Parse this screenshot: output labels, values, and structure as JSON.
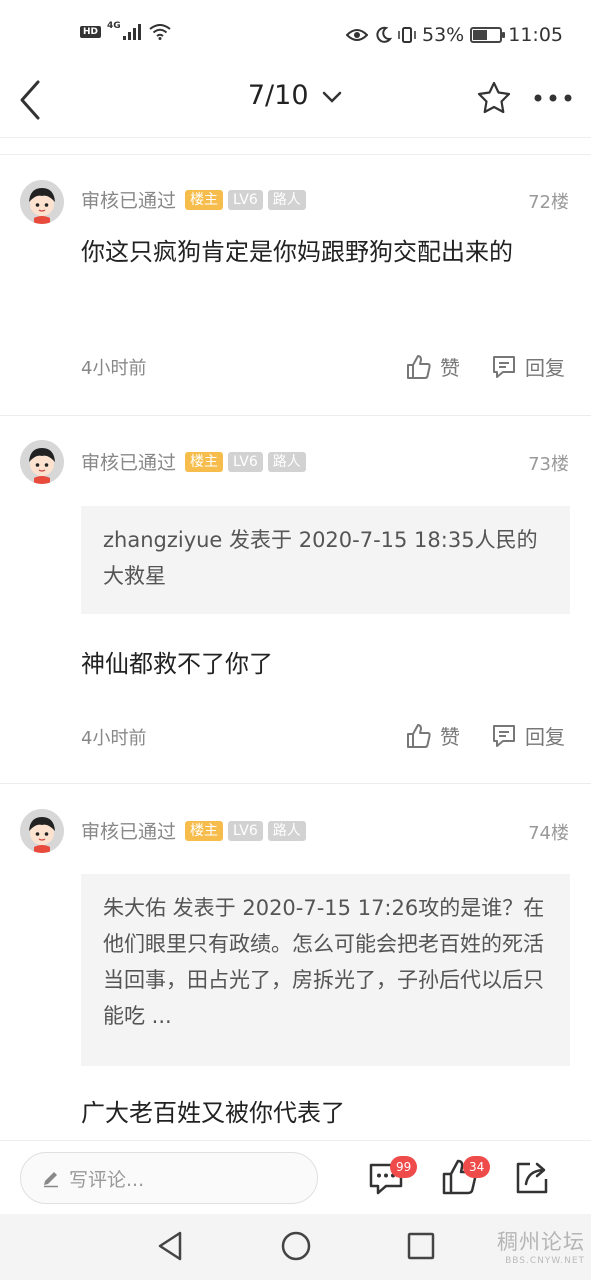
{
  "status_bar": {
    "hd": "HD",
    "network": "4G",
    "battery_percent": "53%",
    "battery_level": 0.53,
    "time": "11:05"
  },
  "topnav": {
    "page_indicator": "7/10"
  },
  "posts": [
    {
      "author": "审核已通过",
      "badge_owner": "楼主",
      "badge_level": "LV6",
      "badge_role": "路人",
      "floor": "72楼",
      "text": "你这只疯狗肯定是你妈跟野狗交配出来的",
      "time": "4小时前",
      "like_label": "赞",
      "reply_label": "回复"
    },
    {
      "author": "审核已通过",
      "badge_owner": "楼主",
      "badge_level": "LV6",
      "badge_role": "路人",
      "floor": "73楼",
      "quote": "zhangziyue 发表于 2020-7-15 18:35人民的大救星",
      "text": "神仙都救不了你了",
      "time": "4小时前",
      "like_label": "赞",
      "reply_label": "回复"
    },
    {
      "author": "审核已通过",
      "badge_owner": "楼主",
      "badge_level": "LV6",
      "badge_role": "路人",
      "floor": "74楼",
      "quote": "朱大佑 发表于 2020-7-15 17:26攻的是谁？在他们眼里只有政绩。怎么可能会把老百姓的死活当回事，田占光了，房拆光了，子孙后代以后只能吃 ...",
      "text": "广大老百姓又被你代表了"
    }
  ],
  "bottom_bar": {
    "comment_placeholder": "写评论...",
    "comment_count": "99",
    "like_count": "34"
  },
  "watermark": {
    "name": "稠州论坛",
    "url": "BBS.CNYW.NET"
  },
  "colors": {
    "owner_badge": "#f6bd4c",
    "level_badge": "#d2d2d2",
    "count_badge": "#ef4b4b"
  }
}
